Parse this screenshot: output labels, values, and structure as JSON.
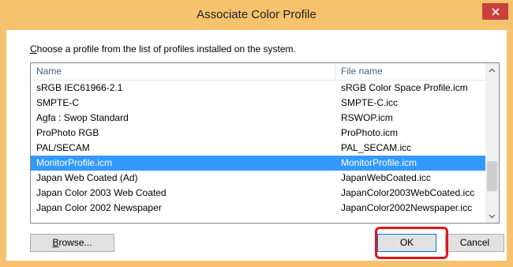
{
  "window": {
    "title": "Associate Color Profile",
    "close_label": "close"
  },
  "prompt": {
    "accel": "C",
    "rest": "hoose a profile from the list of profiles installed on the system."
  },
  "list": {
    "columns": [
      "Name",
      "File name"
    ],
    "rows": [
      {
        "name": "sRGB IEC61966-2.1",
        "file": "sRGB Color Space Profile.icm",
        "selected": false
      },
      {
        "name": "SMPTE-C",
        "file": "SMPTE-C.icc",
        "selected": false
      },
      {
        "name": "Agfa : Swop Standard",
        "file": "RSWOP.icm",
        "selected": false
      },
      {
        "name": "ProPhoto RGB",
        "file": "ProPhoto.icm",
        "selected": false
      },
      {
        "name": "PAL/SECAM",
        "file": "PAL_SECAM.icc",
        "selected": false
      },
      {
        "name": "MonitorProfile.icm",
        "file": "MonitorProfile.icm",
        "selected": true
      },
      {
        "name": "Japan Web Coated (Ad)",
        "file": "JapanWebCoated.icc",
        "selected": false
      },
      {
        "name": "Japan Color 2003 Web Coated",
        "file": "JapanColor2003WebCoated.icc",
        "selected": false
      },
      {
        "name": "Japan Color 2002 Newspaper",
        "file": "JapanColor2002Newspaper.icc",
        "selected": false
      }
    ]
  },
  "buttons": {
    "browse_accel": "B",
    "browse_rest": "rowse...",
    "ok": "OK",
    "cancel": "Cancel"
  },
  "colors": {
    "title_bar": "#f6c26e",
    "selection": "#3399ff",
    "highlight_box": "#e3141b",
    "close_button": "#c9403a"
  },
  "icons": {
    "close": "close-x-icon",
    "scroll_up": "chevron-up-icon",
    "scroll_down": "chevron-down-icon"
  }
}
